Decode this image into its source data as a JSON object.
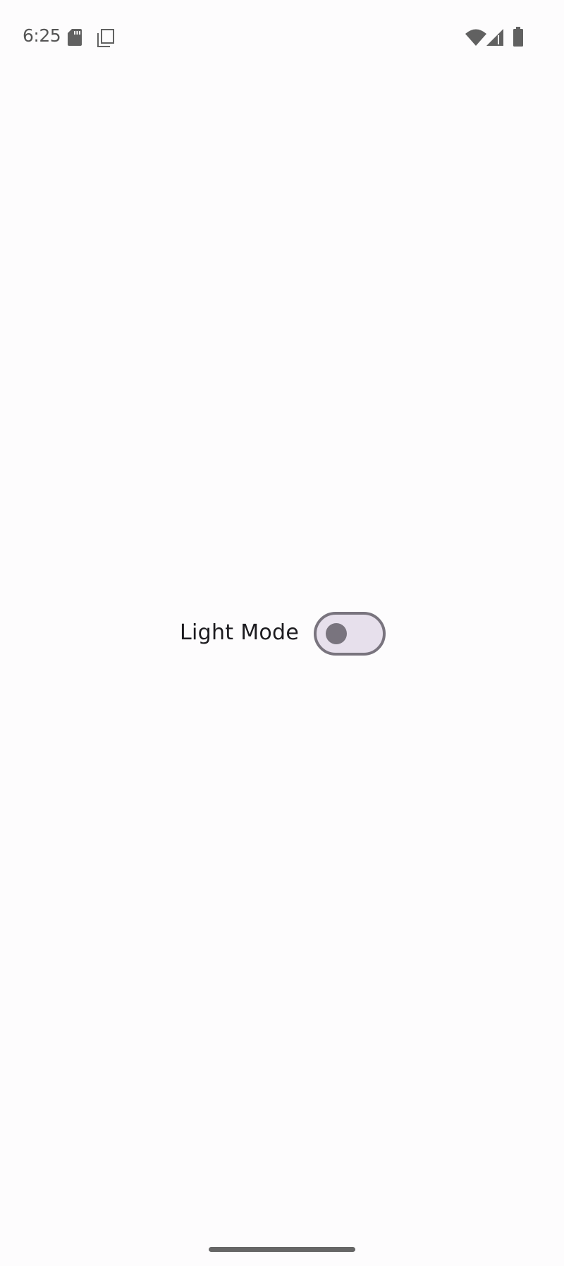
{
  "status_bar": {
    "time": "6:25",
    "left_icons": [
      "sd-card-icon",
      "copy-icon"
    ],
    "right_icons": [
      "wifi-icon",
      "cell-signal-icon",
      "battery-icon"
    ],
    "icon_color": "#616161"
  },
  "main": {
    "toggle_label": "Light Mode",
    "toggle_checked": false,
    "toggle_colors": {
      "track": "#e7e0ec",
      "outline": "#79747e",
      "thumb": "#79747e"
    }
  }
}
